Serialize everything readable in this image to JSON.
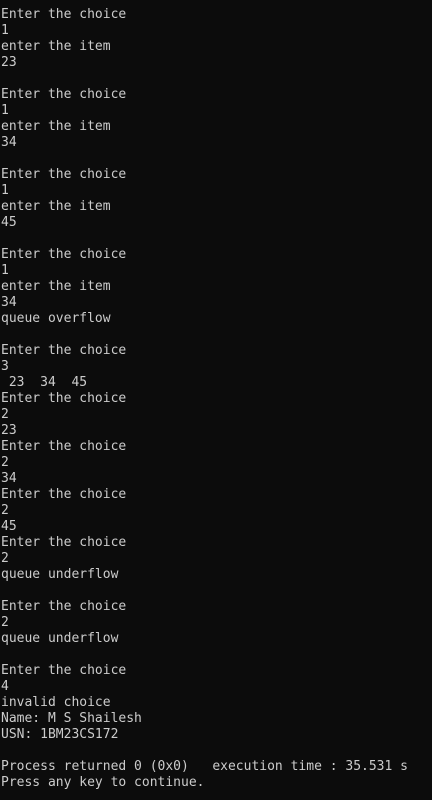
{
  "console": {
    "lines": [
      "Enter the choice",
      "1",
      "enter the item",
      "23",
      "",
      "Enter the choice",
      "1",
      "enter the item",
      "34",
      "",
      "Enter the choice",
      "1",
      "enter the item",
      "45",
      "",
      "Enter the choice",
      "1",
      "enter the item",
      "34",
      "queue overflow",
      "",
      "Enter the choice",
      "3",
      " 23  34  45",
      "Enter the choice",
      "2",
      "23",
      "Enter the choice",
      "2",
      "34",
      "Enter the choice",
      "2",
      "45",
      "Enter the choice",
      "2",
      "queue underflow",
      "",
      "Enter the choice",
      "2",
      "queue underflow",
      "",
      "Enter the choice",
      "4",
      "invalid choice",
      "Name: M S Shailesh",
      "USN: 1BM23CS172",
      "",
      "Process returned 0 (0x0)   execution time : 35.531 s",
      "Press any key to continue."
    ]
  },
  "colors": {
    "background": "#0c0c0c",
    "text": "#cccccc"
  }
}
